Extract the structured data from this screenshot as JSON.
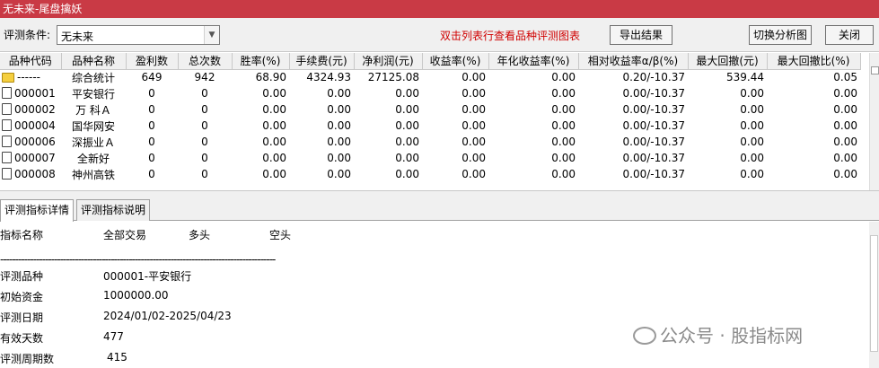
{
  "window": {
    "title": "无未来-尾盘擒妖"
  },
  "toolbar": {
    "condition_label": "评测条件:",
    "condition_value": "无未来",
    "hint": "双击列表行查看品种评测图表",
    "export_label": "导出结果",
    "switch_label": "切换分析图",
    "close_label": "关闭"
  },
  "table": {
    "columns": [
      "品种代码",
      "品种名称",
      "盈利数",
      "总次数",
      "胜率(%)",
      "手续费(元)",
      "净利润(元)",
      "收益率(%)",
      "年化收益率(%)",
      "相对收益率α/β(%)",
      "最大回撤(元)",
      "最大回撤比(%)"
    ],
    "rows": [
      {
        "icon": "folder-icon",
        "cells": [
          "------",
          "综合统计",
          "649",
          "942",
          "68.90",
          "4324.93",
          "27125.08",
          "0.00",
          "0.00",
          "0.20/-10.37",
          "539.44",
          "0.05"
        ]
      },
      {
        "icon": "document-icon",
        "cells": [
          "000001",
          "平安银行",
          "0",
          "0",
          "0.00",
          "0.00",
          "0.00",
          "0.00",
          "0.00",
          "0.00/-10.37",
          "0.00",
          "0.00"
        ]
      },
      {
        "icon": "document-icon",
        "cells": [
          "000002",
          "万 科Ａ",
          "0",
          "0",
          "0.00",
          "0.00",
          "0.00",
          "0.00",
          "0.00",
          "0.00/-10.37",
          "0.00",
          "0.00"
        ]
      },
      {
        "icon": "document-icon",
        "cells": [
          "000004",
          "国华网安",
          "0",
          "0",
          "0.00",
          "0.00",
          "0.00",
          "0.00",
          "0.00",
          "0.00/-10.37",
          "0.00",
          "0.00"
        ]
      },
      {
        "icon": "document-icon",
        "cells": [
          "000006",
          "深振业Ａ",
          "0",
          "0",
          "0.00",
          "0.00",
          "0.00",
          "0.00",
          "0.00",
          "0.00/-10.37",
          "0.00",
          "0.00"
        ]
      },
      {
        "icon": "document-icon",
        "cells": [
          "000007",
          "全新好",
          "0",
          "0",
          "0.00",
          "0.00",
          "0.00",
          "0.00",
          "0.00",
          "0.00/-10.37",
          "0.00",
          "0.00"
        ]
      },
      {
        "icon": "document-icon",
        "cells": [
          "000008",
          "神州高铁",
          "0",
          "0",
          "0.00",
          "0.00",
          "0.00",
          "0.00",
          "0.00",
          "0.00/-10.37",
          "0.00",
          "0.00"
        ]
      }
    ]
  },
  "tabs": [
    {
      "label": "评测指标详情",
      "active": true
    },
    {
      "label": "评测指标说明",
      "active": false
    }
  ],
  "detail": {
    "headers": {
      "name": "指标名称",
      "all": "全部交易",
      "long": "多头",
      "short": "空头"
    },
    "separator": "--------------------------------------------------------------------------------------------",
    "items": [
      {
        "label": "评测品种",
        "value": "000001-平安银行"
      },
      {
        "label": "初始资金",
        "value": "1000000.00"
      },
      {
        "label": "评测日期",
        "value": "2024/01/02-2025/04/23"
      },
      {
        "label": "有效天数",
        "value": "477"
      },
      {
        "label": "评测周期数",
        "value": "415"
      }
    ]
  },
  "watermark": {
    "text": "公众号 · 股指标网"
  }
}
